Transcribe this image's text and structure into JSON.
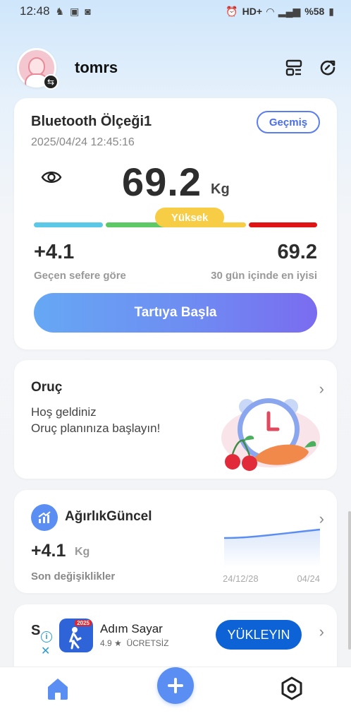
{
  "status_bar": {
    "time": "12:48",
    "network": "HD+",
    "battery": "%58"
  },
  "header": {
    "username": "tomrs"
  },
  "scale_card": {
    "title": "Bluetooth Ölçeği1",
    "date": "2025/04/24 12:45:16",
    "history_label": "Geçmiş",
    "weight": "69.2",
    "unit": "Kg",
    "status_pill": "Yüksek",
    "status_level_fraction": 0.55,
    "bmi_colors": [
      "#5bc8e8",
      "#5cc866",
      "#f7cd46",
      "#e01414"
    ],
    "delta_value": "+4.1",
    "delta_label": "Geçen sefere göre",
    "best_value": "69.2",
    "best_label": "30 gün içinde en iyisi",
    "start_button": "Tartıya Başla"
  },
  "fasting_card": {
    "title": "Oruç",
    "line1": "Hoş geldiniz",
    "line2": "Oruç planınıza başlayın!"
  },
  "weight_trend_card": {
    "title": "AğırlıkGüncel",
    "delta": "+4.1",
    "unit": "Kg",
    "subtitle": "Son değişiklikler",
    "date_start": "24/12/28",
    "date_end": "04/24"
  },
  "ad_card": {
    "letter": "S",
    "app_badge": "2025",
    "app_name": "Adım Sayar",
    "rating": "4.9 ★",
    "price": "ÜCRETSİZ",
    "install_label": "YÜKLEYIN"
  },
  "colors": {
    "accent": "#5b8ef2",
    "install": "#0d63d6"
  }
}
